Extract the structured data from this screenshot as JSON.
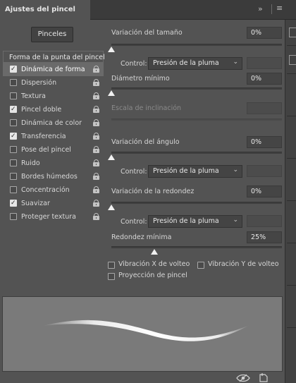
{
  "panel": {
    "tab_title": "Ajustes del pincel",
    "presets_button": "Pinceles"
  },
  "list": {
    "header": "Forma de la punta del pincel",
    "items": [
      {
        "label": "Dinámica de forma",
        "checked": true,
        "selected": true
      },
      {
        "label": "Dispersión",
        "checked": false,
        "selected": false
      },
      {
        "label": "Textura",
        "checked": false,
        "selected": false
      },
      {
        "label": "Pincel doble",
        "checked": true,
        "selected": false
      },
      {
        "label": "Dinámica de color",
        "checked": false,
        "selected": false
      },
      {
        "label": "Transferencia",
        "checked": true,
        "selected": false
      },
      {
        "label": "Pose del pincel",
        "checked": false,
        "selected": false
      },
      {
        "label": "Ruido",
        "checked": false,
        "selected": false
      },
      {
        "label": "Bordes húmedos",
        "checked": false,
        "selected": false
      },
      {
        "label": "Concentración",
        "checked": false,
        "selected": false
      },
      {
        "label": "Suavizar",
        "checked": true,
        "selected": false
      },
      {
        "label": "Proteger textura",
        "checked": false,
        "selected": false
      }
    ]
  },
  "settings": {
    "size_jitter": {
      "label": "Variación del tamaño",
      "value": "0%",
      "level": 0
    },
    "control_1": {
      "label": "Control:",
      "value": "Presión de la pluma"
    },
    "min_diameter": {
      "label": "Diámetro mínimo",
      "value": "0%",
      "level": 0
    },
    "tilt_scale": {
      "label": "Escala de inclinación",
      "value": ""
    },
    "angle_jitter": {
      "label": "Variación del ángulo",
      "value": "0%",
      "level": 0
    },
    "control_2": {
      "label": "Control:",
      "value": "Presión de la pluma"
    },
    "roundness_jitter": {
      "label": "Variación de la redondez",
      "value": "0%",
      "level": 0
    },
    "control_3": {
      "label": "Control:",
      "value": "Presión de la pluma"
    },
    "min_roundness": {
      "label": "Redondez mínima",
      "value": "25%",
      "level": 0.25
    }
  },
  "options": {
    "flip_x": {
      "label": "Vibración X de volteo",
      "checked": false
    },
    "flip_y": {
      "label": "Vibración Y de volteo",
      "checked": false
    },
    "brush_projection": {
      "label": "Proyección de pincel",
      "checked": false
    }
  },
  "icons": {
    "expand": "double-chevron-right-icon",
    "menu": "hamburger-menu-icon",
    "lock": "lock-icon",
    "toggle_preview": "eye-icon",
    "new_preset": "new-preset-icon"
  },
  "colors": {
    "panel_bg": "#535353",
    "selected_row": "#6a6a6a",
    "preview_bg": "#7a7a7a"
  }
}
